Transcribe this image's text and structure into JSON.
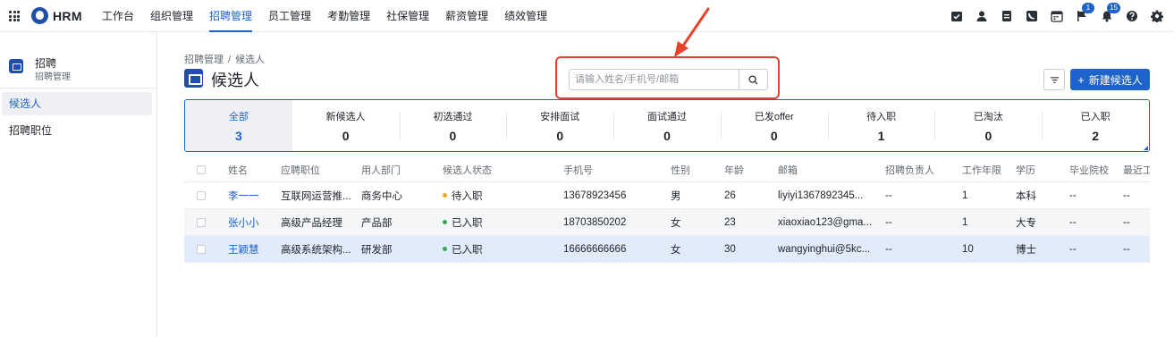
{
  "app": {
    "title": "HRM"
  },
  "nav": [
    {
      "label": "工作台",
      "active": false
    },
    {
      "label": "组织管理",
      "active": false
    },
    {
      "label": "招聘管理",
      "active": true
    },
    {
      "label": "员工管理",
      "active": false
    },
    {
      "label": "考勤管理",
      "active": false
    },
    {
      "label": "社保管理",
      "active": false
    },
    {
      "label": "薪资管理",
      "active": false
    },
    {
      "label": "绩效管理",
      "active": false
    }
  ],
  "top_icons": [
    {
      "name": "calendar-check-icon"
    },
    {
      "name": "user-icon"
    },
    {
      "name": "document-icon"
    },
    {
      "name": "phone-icon"
    },
    {
      "name": "calendar-icon"
    },
    {
      "name": "flag-icon",
      "badge": "1"
    },
    {
      "name": "bell-icon",
      "badge": "15"
    },
    {
      "name": "help-icon"
    },
    {
      "name": "settings-icon"
    }
  ],
  "sidebar": {
    "title": "招聘",
    "subtitle": "招聘管理",
    "items": [
      {
        "label": "候选人",
        "active": true
      },
      {
        "label": "招聘职位",
        "active": false
      }
    ]
  },
  "breadcrumb": {
    "parent": "招聘管理",
    "separator": "/",
    "current": "候选人"
  },
  "page": {
    "title": "候选人"
  },
  "search": {
    "placeholder": "请输入姓名/手机号/邮箱",
    "value": ""
  },
  "actions": {
    "new_label": "新建候选人"
  },
  "stats": [
    {
      "label": "全部",
      "count": "3",
      "active": true
    },
    {
      "label": "新候选人",
      "count": "0"
    },
    {
      "label": "初选通过",
      "count": "0"
    },
    {
      "label": "安排面试",
      "count": "0"
    },
    {
      "label": "面试通过",
      "count": "0"
    },
    {
      "label": "已发offer",
      "count": "0"
    },
    {
      "label": "待入职",
      "count": "1"
    },
    {
      "label": "已淘汰",
      "count": "0"
    },
    {
      "label": "已入职",
      "count": "2"
    }
  ],
  "table": {
    "columns": [
      "姓名",
      "应聘职位",
      "用人部门",
      "候选人状态",
      "手机号",
      "性别",
      "年龄",
      "邮箱",
      "招聘负责人",
      "工作年限",
      "学历",
      "毕业院校",
      "最近工"
    ],
    "rows": [
      {
        "name": "李一一",
        "position": "互联网运营推...",
        "dept": "商务中心",
        "status": "待入职",
        "phone": "13678923456",
        "gender": "男",
        "age": "26",
        "email": "liyiyi1367892345...",
        "recruiter": "--",
        "years": "1",
        "education": "本科",
        "school": "--",
        "recent": "--"
      },
      {
        "name": "张小小",
        "position": "高级产品经理",
        "dept": "产品部",
        "status": "已入职",
        "phone": "18703850202",
        "gender": "女",
        "age": "23",
        "email": "xiaoxiao123@gma...",
        "recruiter": "--",
        "years": "1",
        "education": "大专",
        "school": "--",
        "recent": "--"
      },
      {
        "name": "王颖慧",
        "position": "高级系统架构...",
        "dept": "研发部",
        "status": "已入职",
        "phone": "16666666666",
        "gender": "女",
        "age": "30",
        "email": "wangyinghui@5kc...",
        "recruiter": "--",
        "years": "10",
        "education": "博士",
        "school": "--",
        "recent": "--"
      }
    ]
  },
  "colors": {
    "accent": "#1d63c9",
    "highlight_box": "#e5432b",
    "status_pending": "#f5a623",
    "status_joined": "#34a853"
  }
}
